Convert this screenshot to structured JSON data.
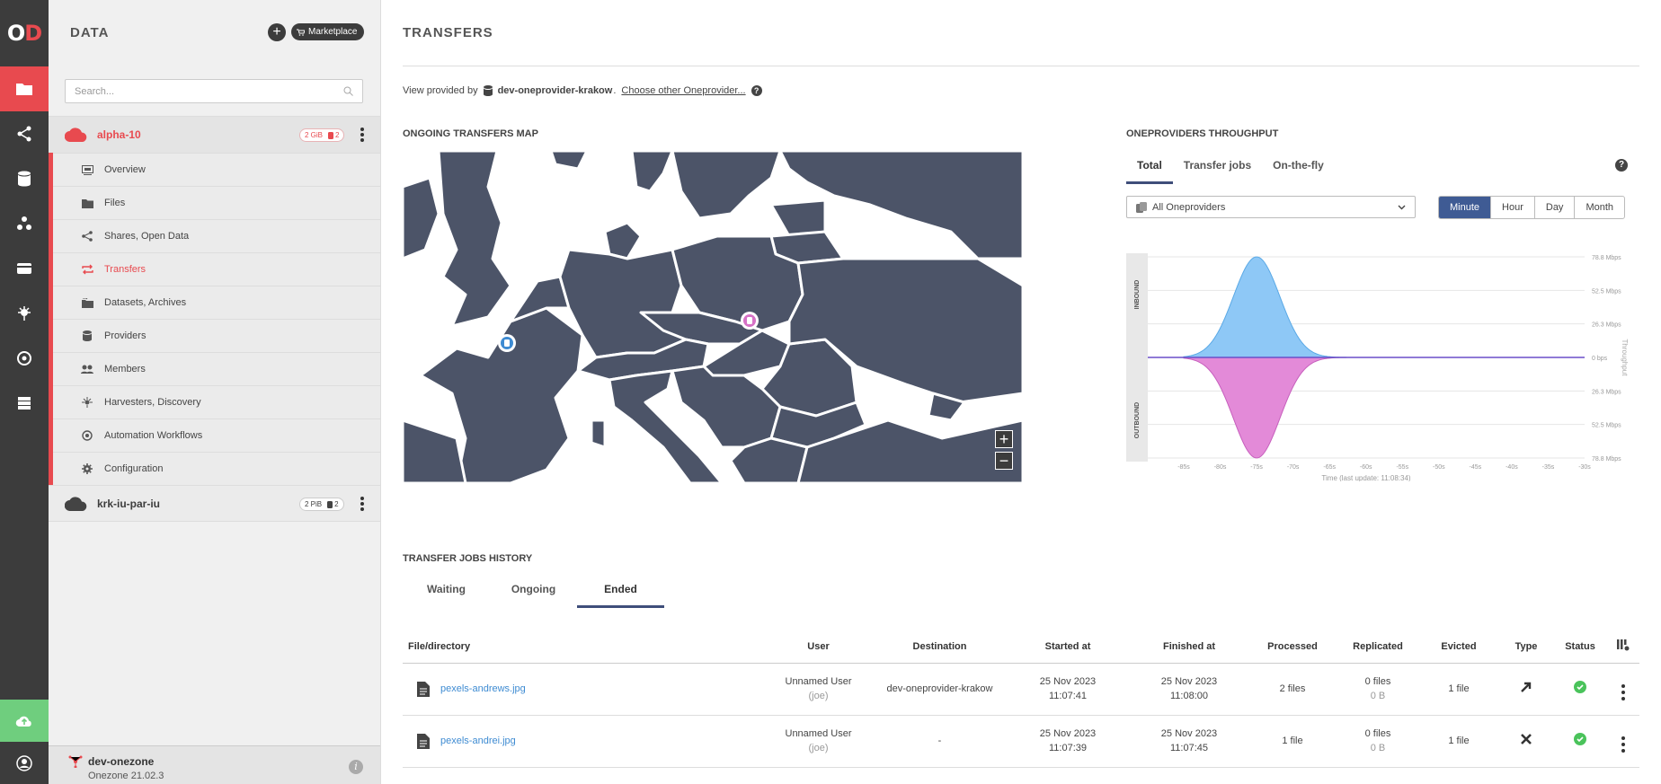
{
  "sidebar": {
    "title": "DATA",
    "marketplace_label": "Marketplace",
    "search_placeholder": "Search...",
    "spaces": [
      {
        "name": "alpha-10",
        "size": "2 GiB",
        "providers": "2"
      },
      {
        "name": "krk-iu-par-iu",
        "size": "2 PiB",
        "providers": "2"
      }
    ],
    "menu": [
      {
        "label": "Overview",
        "icon": "overview-icon"
      },
      {
        "label": "Files",
        "icon": "folder-icon"
      },
      {
        "label": "Shares, Open Data",
        "icon": "share-icon"
      },
      {
        "label": "Transfers",
        "icon": "transfers-icon"
      },
      {
        "label": "Datasets, Archives",
        "icon": "datasets-icon"
      },
      {
        "label": "Providers",
        "icon": "database-icon"
      },
      {
        "label": "Members",
        "icon": "members-icon"
      },
      {
        "label": "Harvesters, Discovery",
        "icon": "harvester-icon"
      },
      {
        "label": "Automation Workflows",
        "icon": "automation-icon"
      },
      {
        "label": "Configuration",
        "icon": "gear-icon"
      }
    ],
    "footer": {
      "zone_name": "dev-onezone",
      "zone_version": "Onezone 21.02.3"
    }
  },
  "main": {
    "title": "TRANSFERS",
    "view_provided_by": "View provided by",
    "provider_name": "dev-oneprovider-krakow",
    "choose_other": "Choose other Oneprovider...",
    "map_title": "ONGOING TRANSFERS MAP",
    "throughput_title": "ONEPROVIDERS THROUGHPUT",
    "throughput_tabs": [
      "Total",
      "Transfer jobs",
      "On-the-fly"
    ],
    "provider_select": "All Oneproviders",
    "periods": [
      "Minute",
      "Hour",
      "Day",
      "Month"
    ],
    "history_title": "TRANSFER JOBS HISTORY",
    "history_tabs": [
      "Waiting",
      "Ongoing",
      "Ended"
    ]
  },
  "chart_data": {
    "type": "area",
    "x": [
      "-85s",
      "-80s",
      "-75s",
      "-70s",
      "-65s",
      "-60s",
      "-55s",
      "-50s",
      "-45s",
      "-40s",
      "-35s",
      "-30s"
    ],
    "y_ticks": [
      "78.8 Mbps",
      "52.5 Mbps",
      "26.3 Mbps",
      "0 bps",
      "26.3 Mbps",
      "52.5 Mbps",
      "78.8 Mbps"
    ],
    "inbound_label": "INBOUND",
    "outbound_label": "OUTBOUND",
    "ylabel": "Throughput",
    "xlabel": "Time (last update: 11:08:34)",
    "series": [
      {
        "name": "INBOUND",
        "values": [
          0,
          10,
          78.8,
          10,
          0,
          0,
          0,
          0,
          0,
          0,
          0,
          0
        ]
      },
      {
        "name": "OUTBOUND",
        "values": [
          0,
          10,
          78.8,
          10,
          0,
          0,
          0,
          0,
          0,
          0,
          0,
          0
        ]
      }
    ],
    "colors": {
      "inbound": "#8ec8f6",
      "outbound": "#e38ad8"
    }
  },
  "table": {
    "headers": [
      "File/directory",
      "User",
      "Destination",
      "Started at",
      "Finished at",
      "Processed",
      "Replicated",
      "Evicted",
      "Type",
      "Status"
    ],
    "rows": [
      {
        "file": "pexels-andrews.jpg",
        "user": "Unnamed User",
        "user_sub": "(joe)",
        "destination": "dev-oneprovider-krakow",
        "started_date": "25 Nov 2023",
        "started_time": "11:07:41",
        "finished_date": "25 Nov 2023",
        "finished_time": "11:08:00",
        "processed": "2 files",
        "replicated": "0 files",
        "replicated_sub": "0 B",
        "evicted": "1 file",
        "type": "migration-icon",
        "status": "success-icon"
      },
      {
        "file": "pexels-andrei.jpg",
        "user": "Unnamed User",
        "user_sub": "(joe)",
        "destination": "-",
        "started_date": "25 Nov 2023",
        "started_time": "11:07:39",
        "finished_date": "25 Nov 2023",
        "finished_time": "11:07:45",
        "processed": "1 file",
        "replicated": "0 files",
        "replicated_sub": "0 B",
        "evicted": "1 file",
        "type": "eviction-icon",
        "status": "success-icon"
      }
    ]
  }
}
